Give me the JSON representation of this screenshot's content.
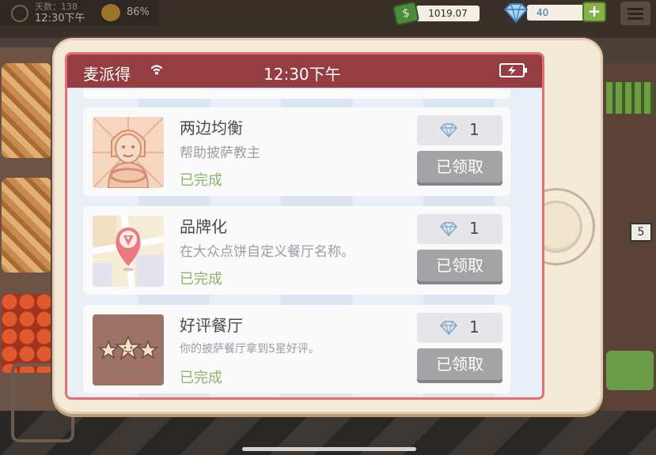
{
  "hud": {
    "day_text": "天数：138",
    "clock_text": "12:30下午",
    "rating_percent": "86%",
    "cash": "1019.07",
    "gems": "40",
    "plus_label": "+"
  },
  "tablet": {
    "app_name": "麦派得",
    "time": "12:30下午"
  },
  "achievements": [
    {
      "title": "两边均衡",
      "description": "帮助披萨教主",
      "status": "已完成",
      "reward_count": "1",
      "button_label": "已领取",
      "thumb": "pizza-master-portrait"
    },
    {
      "title": "品牌化",
      "description": "在大众点饼自定义餐厅名称。",
      "status": "已完成",
      "reward_count": "1",
      "button_label": "已领取",
      "thumb": "map-pizza-pin"
    },
    {
      "title": "好评餐厅",
      "description": "你的披萨餐厅拿到5星好评。",
      "status": "已完成",
      "reward_count": "1",
      "button_label": "已领取",
      "thumb": "three-stars"
    }
  ],
  "colors": {
    "status_bar": "#953d41",
    "screen_border": "#e36f73",
    "completed_text": "#8fb36b",
    "claimed_button": "#a4a3a6"
  }
}
